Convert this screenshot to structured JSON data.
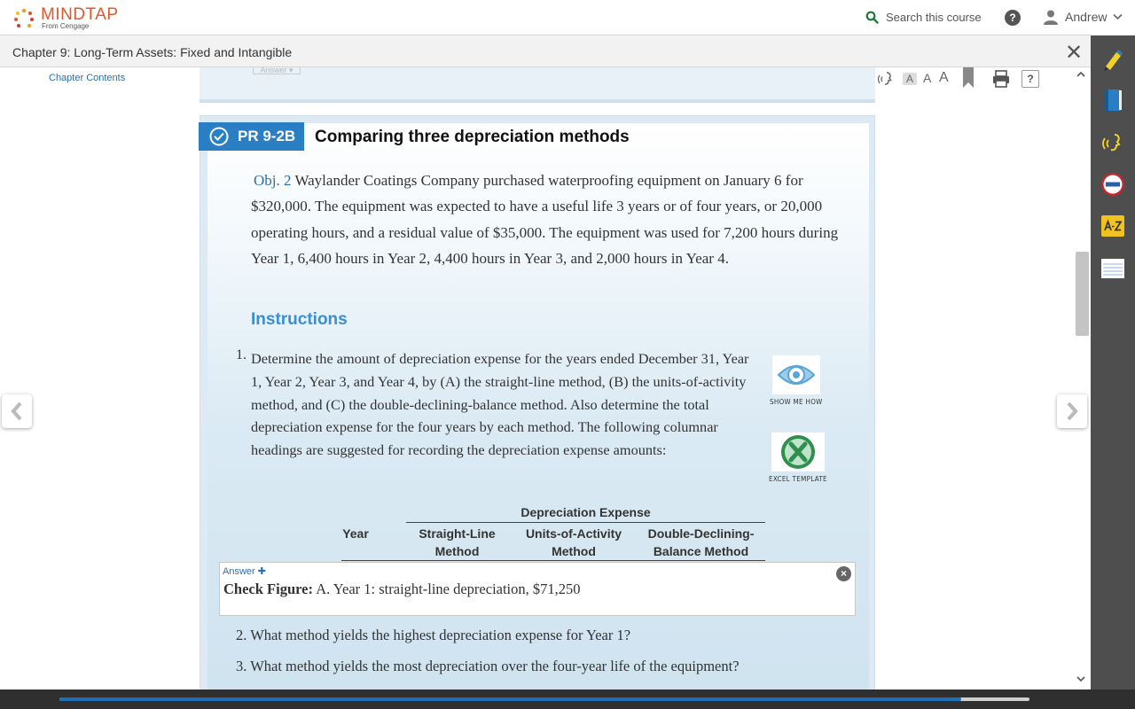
{
  "header": {
    "logo_text": "MINDTAP",
    "logo_sub": "From Cengage",
    "search_label": "Search this course",
    "help_label": "?",
    "user_name": "Andrew"
  },
  "chapter_bar": {
    "title": "Chapter 9: Long-Term Assets: Fixed and Intangible",
    "close_label": "✕"
  },
  "nav": {
    "chapter_contents": "Chapter Contents"
  },
  "reader_toolbar": {
    "font_sizes": [
      "A",
      "A",
      "A"
    ],
    "help_label": "?"
  },
  "previous_item": {
    "answer_tab": "Answer ▾"
  },
  "problem": {
    "badge": "PR 9-2B",
    "title": "Comparing three depreciation methods",
    "objective": "Obj. 2",
    "intro": "Waylander Coatings Company purchased waterproofing equipment on January 6 for $320,000. The equipment was expected to have a useful life 3 years or of four years, or 20,000 operating hours, and a residual value of $35,000. The equipment was used for 7,200 hours during Year 1, 6,400 hours in Year 2, 4,400 hours in Year 3, and 2,000 hours in Year 4.",
    "instructions_heading": "Instructions",
    "questions": [
      {
        "num": "1.",
        "text": "Determine the amount of depreciation expense for the years ended December 31, Year 1, Year 2, Year 3, and Year 4, by (A) the straight-line method, (B) the units-of-activity method, and (C) the double-declining-balance method. Also determine the total depreciation expense for the four years by each method. The following columnar headings are suggested for recording the depreciation expense amounts:"
      },
      {
        "num": "2.",
        "text": "What method yields the highest depreciation expense for Year 1?"
      },
      {
        "num": "3.",
        "text": "What method yields the most depreciation over the four-year life of the equipment?"
      }
    ],
    "resources": {
      "show_me_how": "SHOW ME HOW",
      "excel_template": "EXCEL TEMPLATE"
    },
    "table_headings": {
      "group": "Depreciation Expense",
      "year": "Year",
      "col1_line1": "Straight-Line",
      "col1_line2": "Method",
      "col2_line1": "Units-of-Activity",
      "col2_line2": "Method",
      "col3_line1": "Double-Declining-",
      "col3_line2": "Balance Method"
    },
    "answer": {
      "label": "Answer ✚",
      "check_figure_label": "Check Figure:",
      "check_figure_text": "A. Year 1: straight-line depreciation, $71,250"
    }
  },
  "progress": {
    "fraction": 0.93
  },
  "colors": {
    "brand_orange": "#e0582b",
    "accent_blue": "#2a7fc4",
    "link_blue": "#2a6fb0",
    "dock_gray": "#4e4e4e"
  }
}
